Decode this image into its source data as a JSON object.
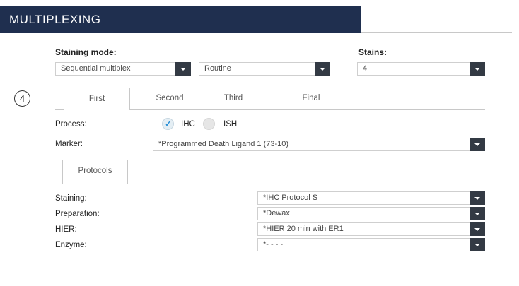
{
  "header": {
    "title": "MULTIPLEXING"
  },
  "step_number": "4",
  "staining_mode": {
    "label": "Staining mode:",
    "mode_value": "Sequential multiplex",
    "type_value": "Routine"
  },
  "stains": {
    "label": "Stains:",
    "value": "4"
  },
  "tabs": [
    "First",
    "Second",
    "Third",
    "Final"
  ],
  "process": {
    "label": "Process:",
    "options": [
      "IHC",
      "ISH"
    ],
    "selected": "IHC"
  },
  "marker": {
    "label": "Marker:",
    "value": "*Programmed Death Ligand 1 (73-10)"
  },
  "protocols_tab": "Protocols",
  "protocol_rows": [
    {
      "label": "Staining:",
      "value": "*IHC Protocol S"
    },
    {
      "label": "Preparation:",
      "value": "*Dewax"
    },
    {
      "label": "HIER:",
      "value": "*HIER 20 min with ER1"
    },
    {
      "label": "Enzyme:",
      "value": "*- - - -"
    }
  ]
}
